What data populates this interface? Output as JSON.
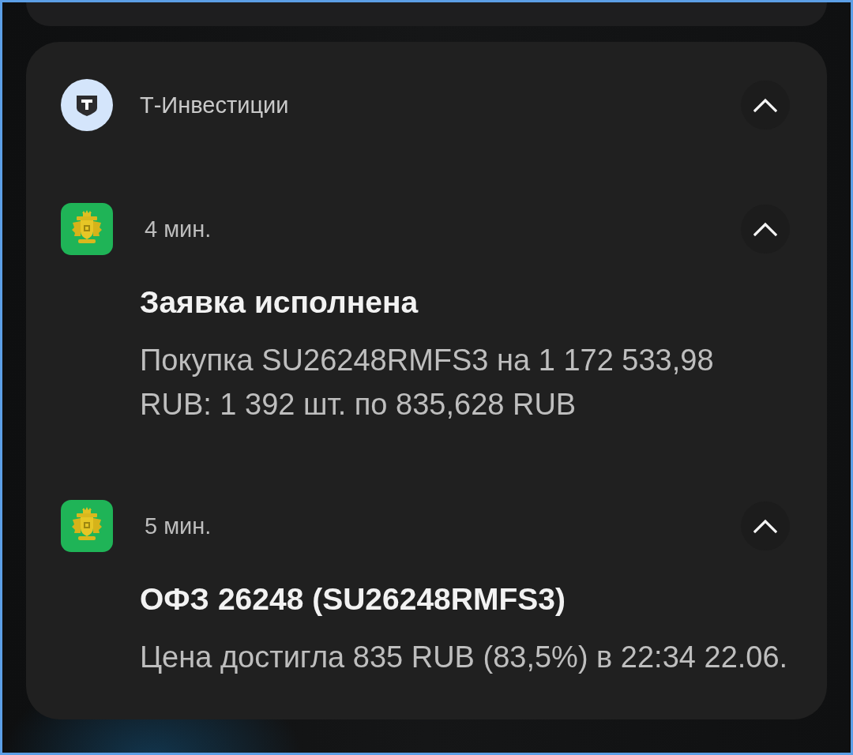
{
  "app_header": {
    "name": "Т-Инвестиции",
    "expanded": true
  },
  "notifications": [
    {
      "time": "4 мин.",
      "expanded": true,
      "title": "Заявка исполнена",
      "text": "Покупка SU26248RMFS3 на 1 172 533,98 RUB: 1 392 шт. по 835,628 RUB"
    },
    {
      "time": "5 мин.",
      "expanded": true,
      "title": "ОФЗ 26248 (SU26248RMFS3)",
      "text": "Цена достигла 835 RUB (83,5%) в 22:34 22.06."
    }
  ]
}
